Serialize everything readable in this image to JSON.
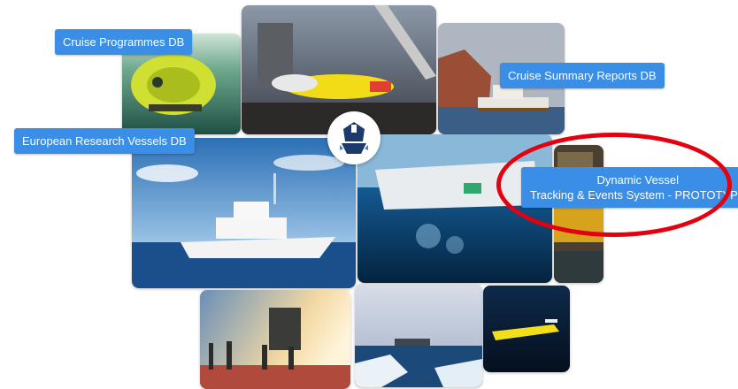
{
  "buttons": {
    "cruise_programmes": "Cruise Programmes DB",
    "cruise_summary_reports": "Cruise Summary Reports DB",
    "european_research_vessels": "European Research Vessels DB",
    "dynamic_vessel_line1": "Dynamic Vessel",
    "dynamic_vessel_line2": "Tracking & Events System - PROTOTYPE"
  },
  "photos": [
    "submersible-underwater-photo",
    "deck-yellow-auv-photo",
    "vessel-by-cliffs-photo",
    "white-research-ship-photo",
    "underwater-view-ship-photo",
    "lab-equipment-photo",
    "crew-deploying-instrument-photo",
    "icebreaker-in-ice-photo",
    "yellow-glider-underwater-photo"
  ],
  "colors": {
    "button_bg": "#3a8ee6",
    "highlight_ring": "#e3000f",
    "logo_navy": "#1d3a6b"
  }
}
